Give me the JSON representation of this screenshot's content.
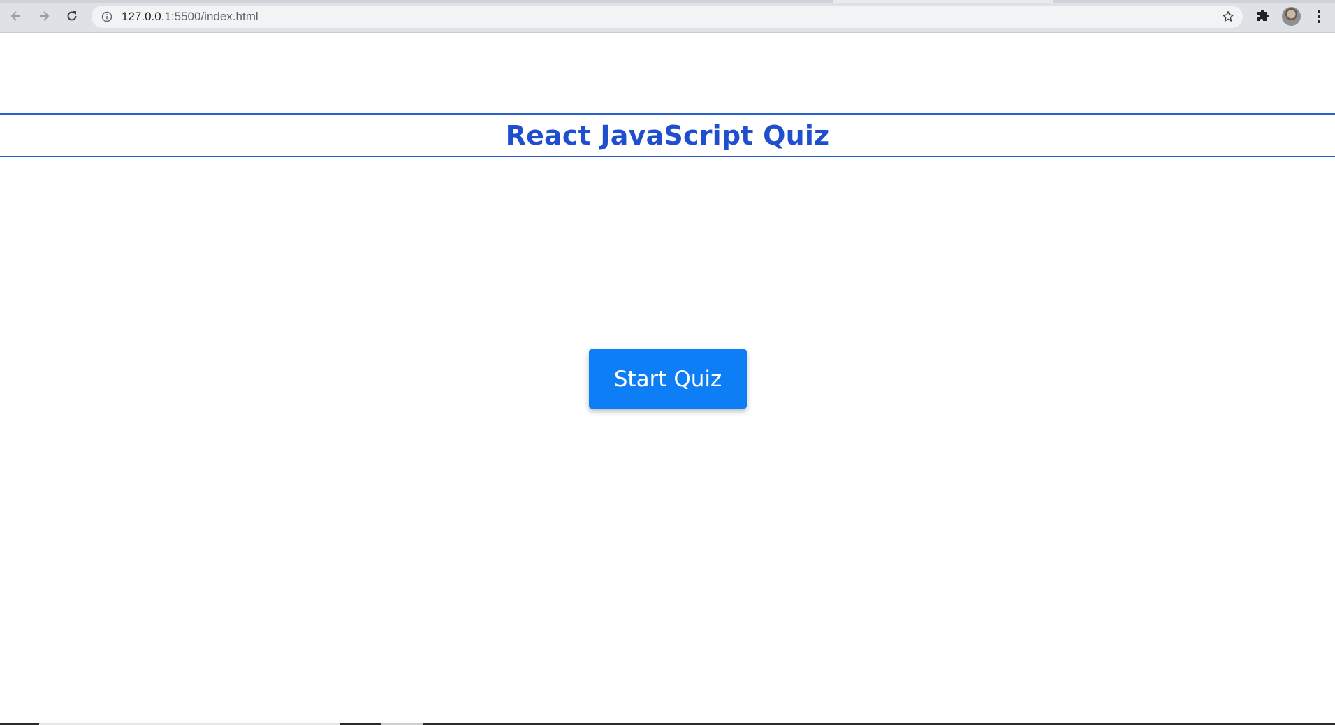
{
  "browser": {
    "url_host": "127.0.0.1",
    "url_path": ":5500/index.html",
    "icons": {
      "back": "arrow-left-icon",
      "forward": "arrow-right-icon",
      "reload": "reload-icon",
      "info": "info-icon",
      "bookmark": "star-icon",
      "extensions": "puzzle-icon",
      "menu": "kebab-menu-icon"
    }
  },
  "page": {
    "title": "React JavaScript Quiz",
    "start_button_label": "Start Quiz"
  },
  "colors": {
    "title": "#1f4fcf",
    "header_border": "#2a5fd0",
    "button_bg": "#0d7ef5",
    "button_text": "#ffffff"
  }
}
